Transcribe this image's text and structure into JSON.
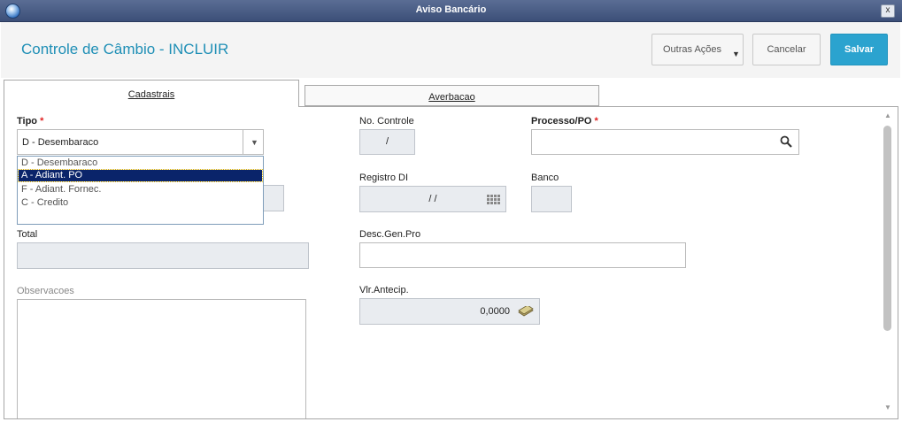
{
  "window": {
    "title": "Aviso Bancário",
    "close_label": "x"
  },
  "header": {
    "title": "Controle de Câmbio - INCLUIR",
    "more_actions_label": "Outras Ações",
    "cancel_label": "Cancelar",
    "save_label": "Salvar"
  },
  "tabs": [
    {
      "label": "Cadastrais",
      "active": true
    },
    {
      "label": "Averbacao",
      "active": false
    }
  ],
  "form": {
    "tipo": {
      "label": "Tipo",
      "required_mark": "*",
      "value": "D - Desembaraco",
      "options": [
        "D - Desembaraco",
        "A - Adiant. PO",
        "F - Adiant. Fornec.",
        "C - Credito"
      ],
      "highlighted_index": 1
    },
    "no_controle": {
      "label": "No. Controle",
      "value": "/"
    },
    "processo": {
      "label": "Processo/PO",
      "required_mark": "*",
      "value": ""
    },
    "registro_di": {
      "label": "Registro DI",
      "value": "/ /"
    },
    "banco": {
      "label": "Banco",
      "value": ""
    },
    "total": {
      "label": "Total",
      "value": ""
    },
    "desc_gen_pro": {
      "label": "Desc.Gen.Pro",
      "value": ""
    },
    "observacoes": {
      "label": "Observacoes",
      "value": ""
    },
    "vlr_antecip": {
      "label": "Vlr.Antecip.",
      "value": "0,0000"
    }
  },
  "colors": {
    "accent": "#2ba3cf",
    "title": "#1f8fb6",
    "selection": "#0a246a",
    "required": "#e02020"
  }
}
